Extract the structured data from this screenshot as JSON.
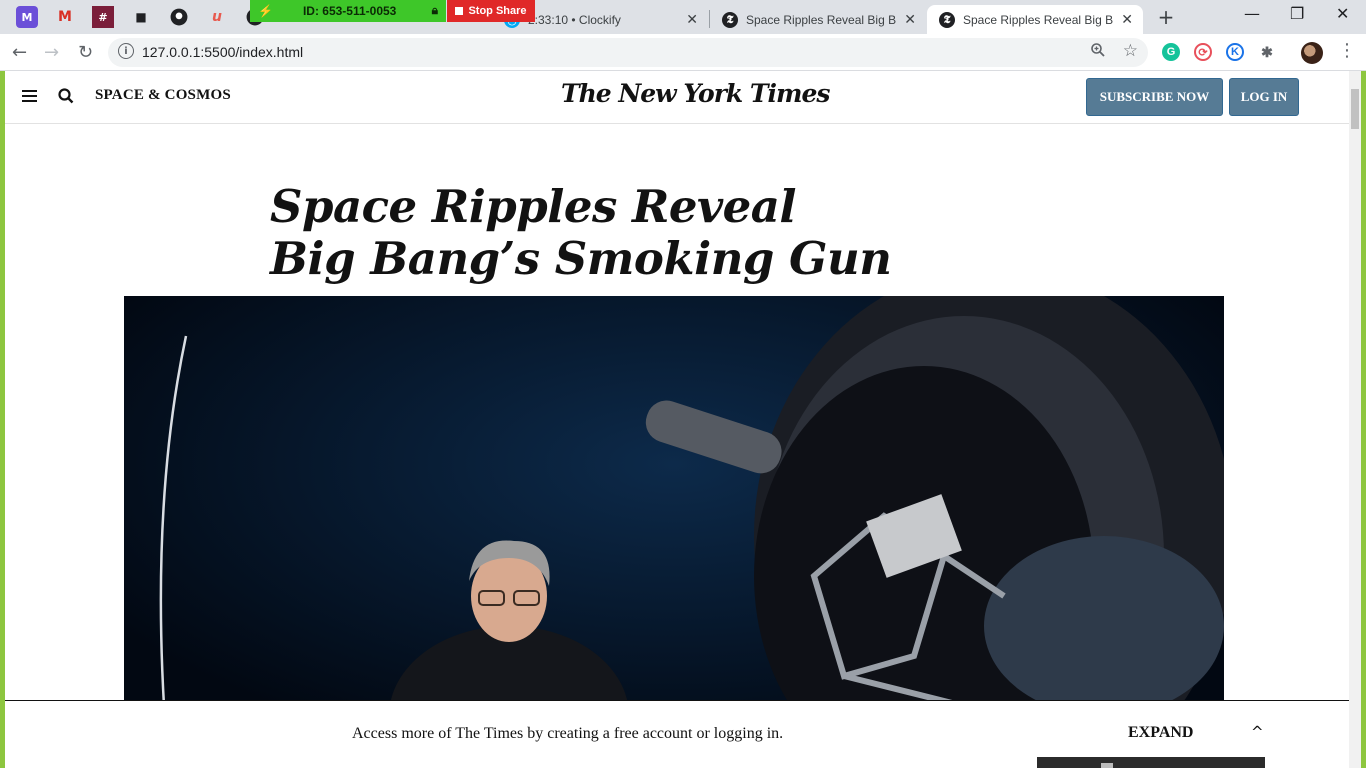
{
  "browser": {
    "tabs": [
      {
        "label": "2:33:10 • Clockify",
        "active": false
      },
      {
        "label": "Space Ripples Reveal Big Bang",
        "active": false
      },
      {
        "label": "Space Ripples Reveal Big Bang",
        "active": true
      }
    ],
    "tab_favicon_letter": "𝕿",
    "tab_close": "✕",
    "new_tab": "+",
    "window_controls": {
      "minimize": "—",
      "restore": "❐",
      "close": "✕"
    },
    "url": "127.0.0.1:5500/index.html",
    "info_glyph": "i"
  },
  "zoom": {
    "meeting_id": "ID: 653-511-0053",
    "stop_share": "Stop Share"
  },
  "nyt": {
    "section": "SPACE & COSMOS",
    "logo": "The New York Times",
    "subscribe": "SUBSCRIBE NOW",
    "login": "LOG IN",
    "headline_line1": "Space Ripples Reveal",
    "headline_line2": "Big Bang’s Smoking Gun"
  },
  "regwall": {
    "message": "Access more of The Times by creating a free account or logging in.",
    "expand": "EXPAND",
    "caret": "^"
  },
  "colors": {
    "share_frame": "#8dc63f",
    "nyt_button": "#567b95",
    "zoom_green": "#3ec729",
    "zoom_red": "#e02828"
  }
}
